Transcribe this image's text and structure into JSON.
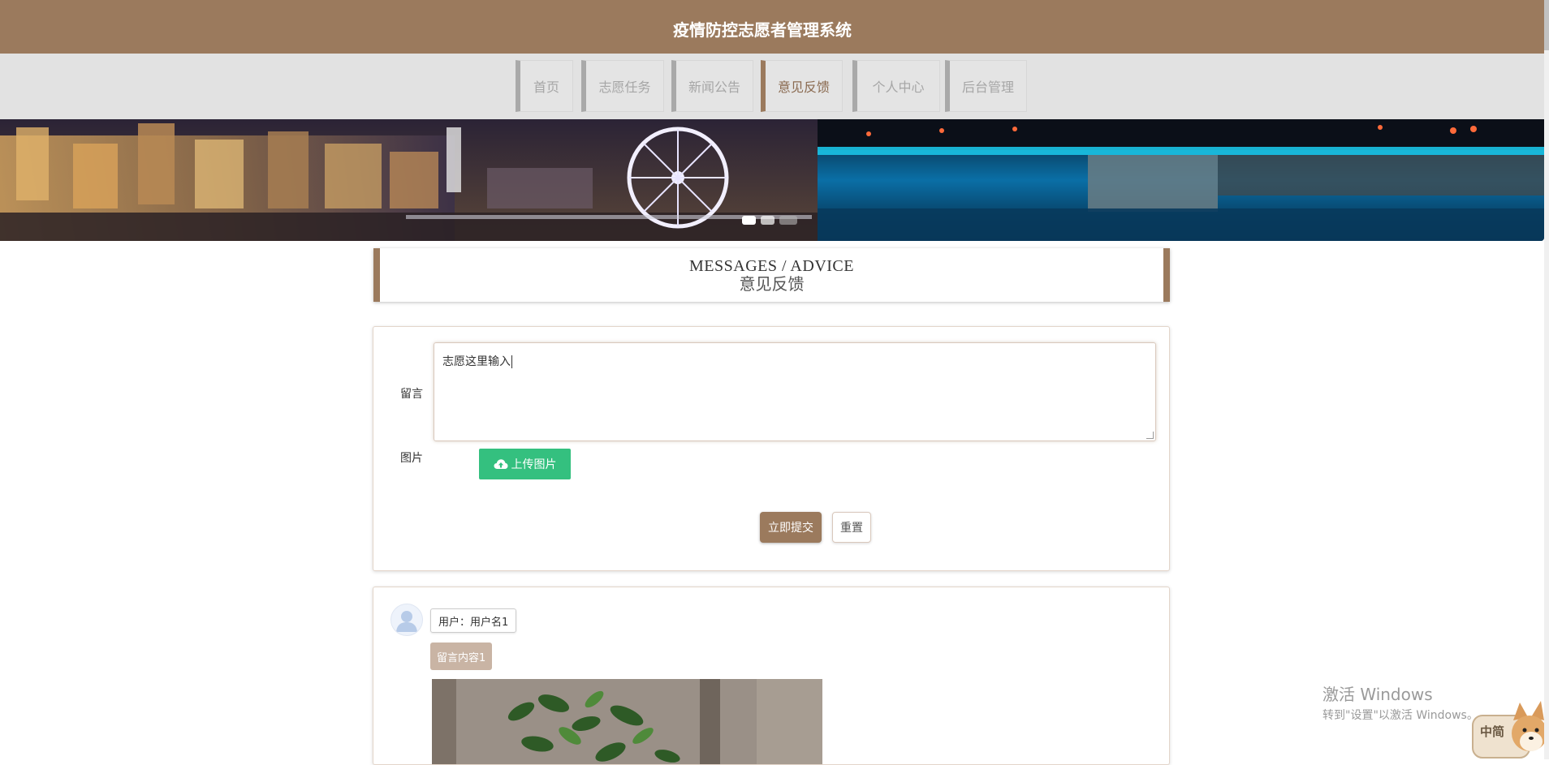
{
  "header": {
    "title": "疫情防控志愿者管理系统"
  },
  "nav": {
    "items": [
      {
        "label": "首页"
      },
      {
        "label": "志愿任务"
      },
      {
        "label": "新闻公告"
      },
      {
        "label": "意见反馈",
        "active": true
      },
      {
        "label": "个人中心"
      },
      {
        "label": "后台管理"
      }
    ]
  },
  "section": {
    "title_en": "MESSAGES / ADVICE",
    "title_cn": "意见反馈"
  },
  "form": {
    "message_label": "留言",
    "message_value": "志愿这里输入",
    "image_label": "图片",
    "upload_label": "上传图片",
    "submit_label": "立即提交",
    "reset_label": "重置"
  },
  "messages": [
    {
      "user": "用户：用户名1",
      "content": "留言内容1"
    }
  ],
  "os_watermark": {
    "line1": "激活 Windows",
    "line2": "转到\"设置\"以激活 Windows。"
  },
  "mascot": {
    "label": "中简"
  },
  "colors": {
    "brand": "#9b7a5d",
    "upload": "#34c07f",
    "nav_bg": "#e2e2e2"
  }
}
